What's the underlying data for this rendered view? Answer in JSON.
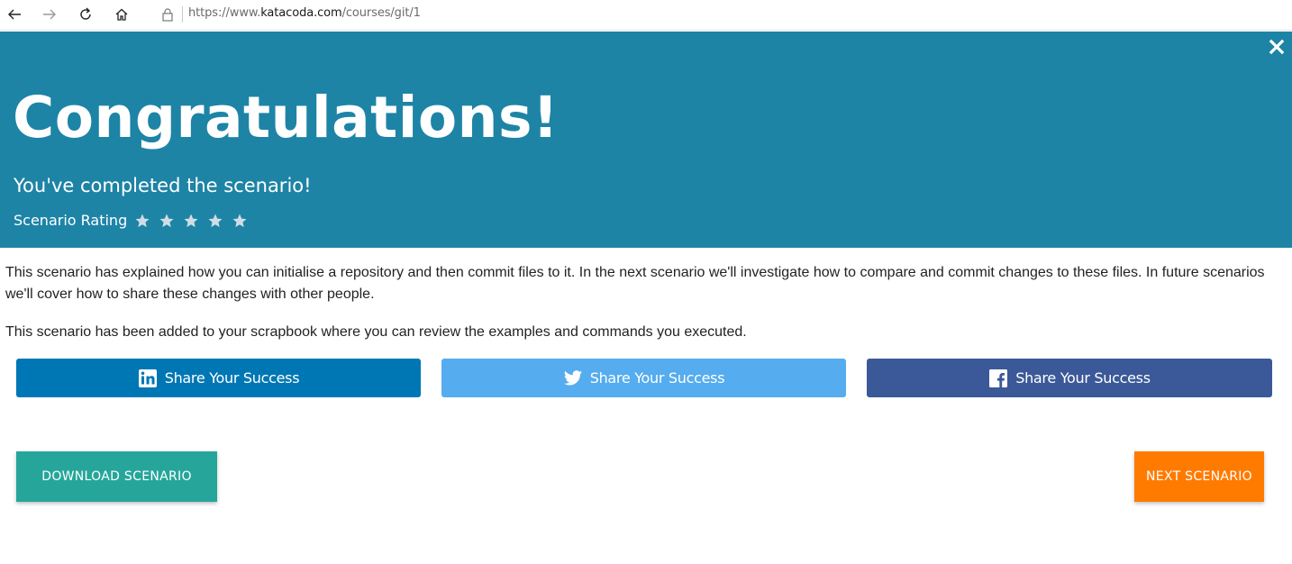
{
  "browser": {
    "url_prefix": "https://www.",
    "url_domain": "katacoda.com",
    "url_path": "/courses/git/1",
    "icons": [
      "back-arrow-icon",
      "forward-arrow-icon",
      "refresh-icon",
      "home-icon",
      "lock-icon"
    ]
  },
  "banner": {
    "title": "Congratulations!",
    "subtitle": "You've completed the scenario!",
    "rating_label": "Scenario Rating",
    "rating_max": 5,
    "rating_value": 0,
    "color": "#1d84a6"
  },
  "content": {
    "paragraph_1": "This scenario has explained how you can initialise a repository and then commit files to it. In the next scenario we'll investigate how to compare and commit changes to these files. In future scenarios we'll cover how to share these changes with other people.",
    "paragraph_2": "This scenario has been added to your scrapbook where you can review the examples and commands you executed."
  },
  "share": {
    "linkedin": {
      "label": "Share Your Success",
      "icon": "linkedin-icon",
      "color": "#0077b5"
    },
    "twitter": {
      "label": "Share Your Success",
      "icon": "twitter-icon",
      "color": "#55acee"
    },
    "facebook": {
      "label": "Share Your Success",
      "icon": "facebook-icon",
      "color": "#3b5998"
    }
  },
  "actions": {
    "download_label": "DOWNLOAD SCENARIO",
    "download_color": "#26a69a",
    "next_label": "NEXT SCENARIO",
    "next_color": "#ff7b00"
  }
}
